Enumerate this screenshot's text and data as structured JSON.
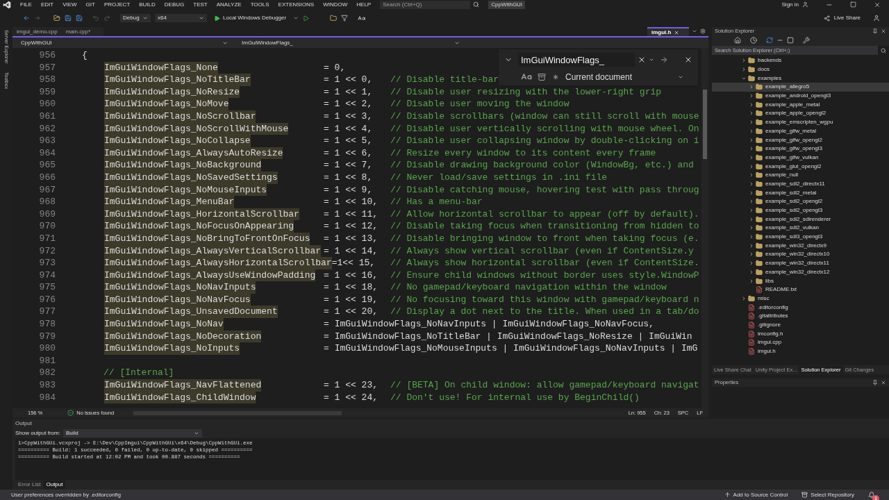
{
  "menu": [
    "FILE",
    "EDIT",
    "VIEW",
    "GIT",
    "PROJECT",
    "BUILD",
    "DEBUG",
    "TEST",
    "ANALYZE",
    "TOOLS",
    "EXTENSIONS",
    "WINDOW",
    "HELP"
  ],
  "search": {
    "placeholder": "Search (Ctrl+Q)"
  },
  "solution_name": "CppWithGUi",
  "account": {
    "sign_in": "Sign in",
    "live_share": "Live Share"
  },
  "toolbar": {
    "configuration": "Debug",
    "platform": "x64",
    "debugger": "Local Windows Debugger"
  },
  "side_strip": [
    "Server Explorer",
    "Toolbox"
  ],
  "doc_tabs": [
    {
      "label": "imgui_demo.cpp",
      "selected": false
    },
    {
      "label": "main.cpp*",
      "selected": false
    },
    {
      "label": "imgui.h",
      "selected": true
    }
  ],
  "nav_bar": {
    "project": "CppWithGUi",
    "scope": "ImGuiWindowFlags_"
  },
  "find": {
    "value": "ImGuiWindowFlags_",
    "scope": "Current document"
  },
  "code": [
    {
      "num": "956",
      "kind": "brace",
      "text": "{"
    },
    {
      "num": "957",
      "kind": "member",
      "name": "ImGuiWindowFlags_None",
      "value": "= 0,"
    },
    {
      "num": "958",
      "kind": "member",
      "name": "ImGuiWindowFlags_NoTitleBar",
      "value": "= 1 << 0,",
      "comment": "// Disable title-bar"
    },
    {
      "num": "959",
      "kind": "member",
      "name": "ImGuiWindowFlags_NoResize",
      "value": "= 1 << 1,",
      "comment": "// Disable user resizing with the lower-right grip"
    },
    {
      "num": "960",
      "kind": "member",
      "name": "ImGuiWindowFlags_NoMove",
      "value": "= 1 << 2,",
      "comment": "// Disable user moving the window"
    },
    {
      "num": "961",
      "kind": "member",
      "name": "ImGuiWindowFlags_NoScrollbar",
      "value": "= 1 << 3,",
      "comment": "// Disable scrollbars (window can still scroll with mouse"
    },
    {
      "num": "962",
      "kind": "member",
      "name": "ImGuiWindowFlags_NoScrollWithMouse",
      "value": "= 1 << 4,",
      "comment": "// Disable user vertically scrolling with mouse wheel. On"
    },
    {
      "num": "963",
      "kind": "member",
      "name": "ImGuiWindowFlags_NoCollapse",
      "value": "= 1 << 5,",
      "comment": "// Disable user collapsing window by double-clicking on i"
    },
    {
      "num": "964",
      "kind": "member",
      "name": "ImGuiWindowFlags_AlwaysAutoResize",
      "value": "= 1 << 6,",
      "comment": "// Resize every window to its content every frame"
    },
    {
      "num": "965",
      "kind": "member",
      "name": "ImGuiWindowFlags_NoBackground",
      "value": "= 1 << 7,",
      "comment": "// Disable drawing background color (WindowBg, etc.) and"
    },
    {
      "num": "966",
      "kind": "member",
      "name": "ImGuiWindowFlags_NoSavedSettings",
      "value": "= 1 << 8,",
      "comment": "// Never load/save settings in .ini file"
    },
    {
      "num": "967",
      "kind": "member",
      "name": "ImGuiWindowFlags_NoMouseInputs",
      "value": "= 1 << 9,",
      "comment": "// Disable catching mouse, hovering test with pass throug"
    },
    {
      "num": "968",
      "kind": "member",
      "name": "ImGuiWindowFlags_MenuBar",
      "value": "= 1 << 10,",
      "comment": "// Has a menu-bar"
    },
    {
      "num": "969",
      "kind": "member",
      "name": "ImGuiWindowFlags_HorizontalScrollbar",
      "value": "= 1 << 11,",
      "comment": "// Allow horizontal scrollbar to appear (off by default)."
    },
    {
      "num": "970",
      "kind": "member",
      "name": "ImGuiWindowFlags_NoFocusOnAppearing",
      "value": "= 1 << 12,",
      "comment": "// Disable taking focus when transitioning from hidden to"
    },
    {
      "num": "971",
      "kind": "member",
      "name": "ImGuiWindowFlags_NoBringToFrontOnFocus",
      "value": "= 1 << 13,",
      "comment": "// Disable bringing window to front when taking focus (e."
    },
    {
      "num": "972",
      "kind": "member",
      "name": "ImGuiWindowFlags_AlwaysVerticalScrollbar",
      "value": "= 1 << 14,",
      "comment": "// Always show vertical scrollbar (even if ContentSize.y"
    },
    {
      "num": "973",
      "kind": "member",
      "name": "ImGuiWindowFlags_AlwaysHorizontalScrollbar",
      "value": "=1<< 15,",
      "comment": "// Always show horizontal scrollbar (even if ContentSize."
    },
    {
      "num": "974",
      "kind": "member",
      "name": "ImGuiWindowFlags_AlwaysUseWindowPadding",
      "value": "= 1 << 16,",
      "comment": "// Ensure child windows without border uses style.WindowP"
    },
    {
      "num": "975",
      "kind": "member",
      "name": "ImGuiWindowFlags_NoNavInputs",
      "value": "= 1 << 18,",
      "comment": "// No gamepad/keyboard navigation within the window"
    },
    {
      "num": "976",
      "kind": "member",
      "name": "ImGuiWindowFlags_NoNavFocus",
      "value": "= 1 << 19,",
      "comment": "// No focusing toward this window with gamepad/keyboard n"
    },
    {
      "num": "977",
      "kind": "member",
      "name": "ImGuiWindowFlags_UnsavedDocument",
      "value": "= 1 << 20,",
      "comment": "// Display a dot next to the title. When used in a tab/do"
    },
    {
      "num": "978",
      "kind": "member",
      "name": "ImGuiWindowFlags_NoNav",
      "value": "= ImGuiWindowFlags_NoNavInputs | ImGuiWindowFlags_NoNavFocus,"
    },
    {
      "num": "979",
      "kind": "member",
      "name": "ImGuiWindowFlags_NoDecoration",
      "value": "= ImGuiWindowFlags_NoTitleBar | ImGuiWindowFlags_NoResize | ImGuiWin"
    },
    {
      "num": "980",
      "kind": "member",
      "name": "ImGuiWindowFlags_NoInputs",
      "value": "= ImGuiWindowFlags_NoMouseInputs | ImGuiWindowFlags_NoNavInputs | ImG"
    },
    {
      "num": "981",
      "kind": "blank"
    },
    {
      "num": "982",
      "kind": "comment",
      "text": "// [Internal]"
    },
    {
      "num": "983",
      "kind": "member",
      "name": "ImGuiWindowFlags_NavFlattened",
      "value": "= 1 << 23,",
      "comment": "// [BETA] On child window: allow gamepad/keyboard navigat"
    },
    {
      "num": "984",
      "kind": "member",
      "name": "ImGuiWindowFlags_ChildWindow",
      "value": "= 1 << 24,",
      "comment": "// Don't use! For internal use by BeginChild()"
    }
  ],
  "editor_status": {
    "zoom": "156 %",
    "issues": "No issues found",
    "line": "Ln: 955",
    "column": "Ch: 23",
    "whitespace": "SPC",
    "line_ending": "LF"
  },
  "solution_explorer": {
    "title": "Solution Explorer",
    "search_placeholder": "Search Solution Explorer (Ctrl+;)",
    "tree": [
      {
        "kind": "folder",
        "label": "backends",
        "expanded": false,
        "selected": false
      },
      {
        "kind": "folder",
        "label": "docs",
        "expanded": false,
        "selected": false
      },
      {
        "kind": "folder",
        "label": "examples",
        "expanded": true,
        "selected": false,
        "children": [
          {
            "kind": "folder",
            "label": "example_allegro5",
            "expanded": false,
            "selected": true
          },
          {
            "kind": "folder",
            "label": "example_android_opengl3",
            "expanded": false,
            "selected": false
          },
          {
            "kind": "folder",
            "label": "example_apple_metal",
            "expanded": false,
            "selected": false
          },
          {
            "kind": "folder",
            "label": "example_apple_opengl2",
            "expanded": false,
            "selected": false
          },
          {
            "kind": "folder",
            "label": "example_emscripten_wgpu",
            "expanded": false,
            "selected": false
          },
          {
            "kind": "folder",
            "label": "example_glfw_metal",
            "expanded": false,
            "selected": false
          },
          {
            "kind": "folder",
            "label": "example_glfw_opengl2",
            "expanded": false,
            "selected": false
          },
          {
            "kind": "folder",
            "label": "example_glfw_opengl3",
            "expanded": false,
            "selected": false
          },
          {
            "kind": "folder",
            "label": "example_glfw_vulkan",
            "expanded": false,
            "selected": false
          },
          {
            "kind": "folder",
            "label": "example_glut_opengl2",
            "expanded": false,
            "selected": false
          },
          {
            "kind": "folder",
            "label": "example_null",
            "expanded": false,
            "selected": false
          },
          {
            "kind": "folder",
            "label": "example_sdl2_directx11",
            "expanded": false,
            "selected": false
          },
          {
            "kind": "folder",
            "label": "example_sdl2_metal",
            "expanded": false,
            "selected": false
          },
          {
            "kind": "folder",
            "label": "example_sdl2_opengl2",
            "expanded": false,
            "selected": false
          },
          {
            "kind": "folder",
            "label": "example_sdl2_opengl3",
            "expanded": false,
            "selected": false
          },
          {
            "kind": "folder",
            "label": "example_sdl2_sdlrenderer",
            "expanded": false,
            "selected": false
          },
          {
            "kind": "folder",
            "label": "example_sdl2_vulkan",
            "expanded": false,
            "selected": false
          },
          {
            "kind": "folder",
            "label": "example_sdl3_opengl3",
            "expanded": false,
            "selected": false
          },
          {
            "kind": "folder",
            "label": "example_win32_directx9",
            "expanded": false,
            "selected": false
          },
          {
            "kind": "folder",
            "label": "example_win32_directx10",
            "expanded": false,
            "selected": false
          },
          {
            "kind": "folder",
            "label": "example_win32_directx11",
            "expanded": false,
            "selected": false
          },
          {
            "kind": "folder",
            "label": "example_win32_directx12",
            "expanded": false,
            "selected": false
          },
          {
            "kind": "folder",
            "label": "libs",
            "expanded": false,
            "selected": false
          },
          {
            "kind": "file",
            "label": "README.txt",
            "selected": false
          }
        ]
      },
      {
        "kind": "folder",
        "label": "misc",
        "expanded": false,
        "selected": false
      },
      {
        "kind": "file",
        "label": ".editorconfig",
        "selected": false
      },
      {
        "kind": "file",
        "label": ".gitattributes",
        "selected": false
      },
      {
        "kind": "file",
        "label": ".gitignore",
        "selected": false
      },
      {
        "kind": "file",
        "label": "imconfig.h",
        "selected": false
      },
      {
        "kind": "file",
        "label": "imgui.cpp",
        "selected": false
      },
      {
        "kind": "file",
        "label": "imgui.h",
        "selected": false
      }
    ],
    "tabs": [
      {
        "label": "Live Share Chat",
        "selected": false
      },
      {
        "label": "Unity Project Ex...",
        "selected": false
      },
      {
        "label": "Solution Explorer",
        "selected": true
      },
      {
        "label": "Git Changes",
        "selected": false
      }
    ]
  },
  "properties": {
    "title": "Properties"
  },
  "output": {
    "title": "Output",
    "source_label": "Show output from:",
    "source": "Build",
    "lines": [
      "1>CppWithGUi.vcxproj -> E:\\Dev\\CppImgui\\CppWithGUi\\x64\\Debug\\CppWithGUi.exe",
      "========== Build: 1 succeeded, 0 failed, 0 up-to-date, 0 skipped ==========",
      "========== Build started at 12:02 PM and took 00.887 seconds =========="
    ],
    "tabs": [
      {
        "label": "Error List",
        "selected": false
      },
      {
        "label": "Output",
        "selected": true
      }
    ]
  },
  "status_bar": {
    "message": "User preferences overridden by .editorconfig",
    "source_control": "Add to Source Control",
    "repository": "Select Repository",
    "notifications": "1"
  }
}
